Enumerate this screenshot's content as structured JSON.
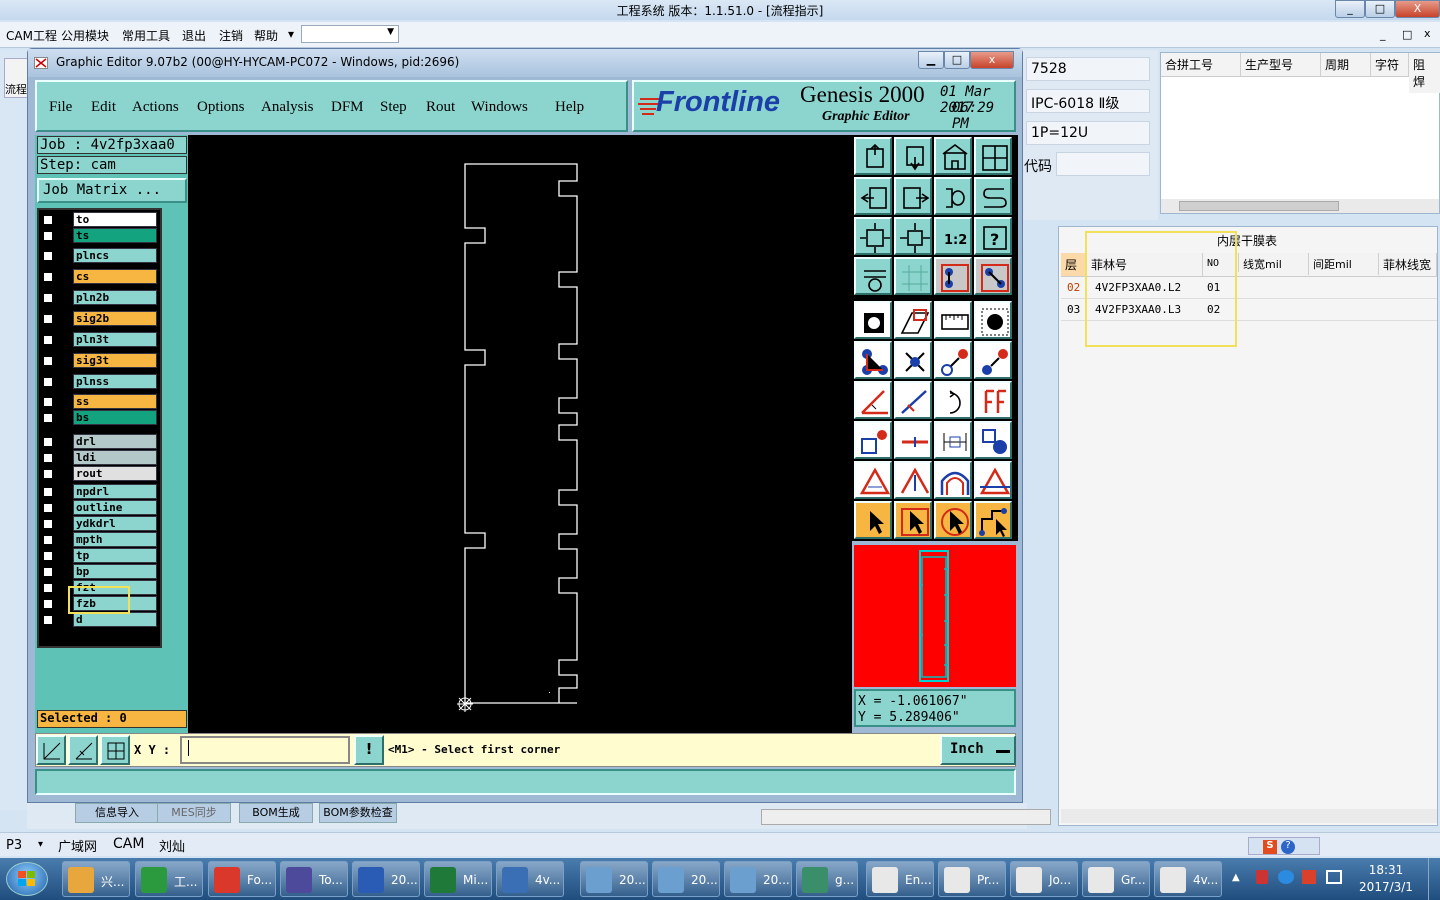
{
  "app": {
    "title": "工程系统    版本：1.1.51.0 - [流程指示]",
    "min": "_",
    "max": "□",
    "close": "X",
    "sub_min": "_",
    "sub_max": "□",
    "sub_close": "x"
  },
  "menu": [
    "CAM工程",
    "公用模块",
    "常用工具",
    "退出",
    "注销",
    "帮助"
  ],
  "menu_help_arrow": "▾",
  "left_stub": "流程",
  "fields": {
    "f1": "7528",
    "f2": "IPC-6018 Ⅱ级",
    "f3": "1P=12U",
    "f4_label": "代码"
  },
  "top_table_headers": [
    "合拼工号",
    "生产型号",
    "周期",
    "字符",
    "阻焊"
  ],
  "film_table": {
    "title": "内层干膜表",
    "headers": [
      "层",
      "菲林号",
      "NO",
      "线宽mil",
      "间距mil",
      "菲林线宽"
    ],
    "rows": [
      [
        "02",
        "4V2FP3XAA0.L2",
        "01"
      ],
      [
        "03",
        "4V2FP3XAA0.L3",
        "02"
      ]
    ]
  },
  "bottom_buttons": [
    "信息导入",
    "MES同步",
    "BOM生成",
    "BOM参数检查"
  ],
  "status_left": {
    "p": "P3",
    "tabs": [
      "广域网",
      "CAM",
      "刘灿"
    ]
  },
  "ge": {
    "title": "Graphic Editor 9.07b2 (00@HY-HYCAM-PC072 - Windows, pid:2696)",
    "menus": [
      "File",
      "Edit",
      "Actions",
      "Options",
      "Analysis",
      "DFM",
      "Step",
      "Rout",
      "Windows",
      "Help"
    ],
    "logo_brand": "Frontline",
    "product": "Genesis 2000",
    "subtitle": "Graphic Editor",
    "date": "01 Mar 2017",
    "time": "06:29 PM",
    "job": "Job : 4v2fp3xaa0",
    "step": "Step: cam",
    "job_matrix": "Job Matrix ...",
    "layers": [
      {
        "name": "to",
        "color": "#ffffff"
      },
      {
        "name": "ts",
        "color": "#13a37e"
      },
      {
        "name": "plncs",
        "color": "#8cd5cf"
      },
      {
        "name": "cs",
        "color": "#f7b641"
      },
      {
        "name": "pln2b",
        "color": "#8cd5cf"
      },
      {
        "name": "sig2b",
        "color": "#f7b641"
      },
      {
        "name": "pln3t",
        "color": "#8cd5cf"
      },
      {
        "name": "sig3t",
        "color": "#f7b641"
      },
      {
        "name": "plnss",
        "color": "#8cd5cf"
      },
      {
        "name": "ss",
        "color": "#f7b641"
      },
      {
        "name": "bs",
        "color": "#13a37e"
      },
      {
        "name": "drl",
        "color": "#b3c8c8"
      },
      {
        "name": "ldi",
        "color": "#b3c8c8"
      },
      {
        "name": "rout",
        "color": "#e0e0e0"
      },
      {
        "name": "npdrl",
        "color": "#8cd5cf"
      },
      {
        "name": "outline",
        "color": "#8cd5cf"
      },
      {
        "name": "ydkdrl",
        "color": "#8cd5cf"
      },
      {
        "name": "mpth",
        "color": "#8cd5cf"
      },
      {
        "name": "tp",
        "color": "#8cd5cf"
      },
      {
        "name": "bp",
        "color": "#8cd5cf"
      },
      {
        "name": "fzt",
        "color": "#8cd5cf"
      },
      {
        "name": "fzb",
        "color": "#8cd5cf"
      },
      {
        "name": "d",
        "color": "#8cd5cf"
      }
    ],
    "selected": "Selected : 0",
    "xy_label": "X Y :",
    "prompt": "<M1> - Select first corner",
    "units": "Inch",
    "coord_x": "X = -1.061067\"",
    "coord_y": "Y = 5.289406\"",
    "excl": "!"
  },
  "tray": {
    "time": "18:31",
    "date": "2017/3/1"
  },
  "taskbar": [
    {
      "label": "兴...",
      "color": "#e8a73c"
    },
    {
      "label": "工...",
      "color": "#2b9a3f"
    },
    {
      "label": "Fo...",
      "color": "#d9382a"
    },
    {
      "label": "To...",
      "color": "#4d4a9c"
    },
    {
      "label": "20...",
      "color": "#2a5bb5"
    },
    {
      "label": "Mi...",
      "color": "#1f7a3a"
    },
    {
      "label": "4v...",
      "color": "#3a6fb5"
    },
    {
      "label": "20...",
      "color": "#6b9fd0"
    },
    {
      "label": "20...",
      "color": "#6b9fd0"
    },
    {
      "label": "20...",
      "color": "#6b9fd0"
    },
    {
      "label": "g...",
      "color": "#3a8f6a"
    },
    {
      "label": "En...",
      "color": "#e8e8e8"
    },
    {
      "label": "Pr...",
      "color": "#e8e8e8"
    },
    {
      "label": "Jo...",
      "color": "#e8e8e8"
    },
    {
      "label": "Gr...",
      "color": "#e8e8e8"
    },
    {
      "label": "4v...",
      "color": "#e8e8e8"
    }
  ]
}
